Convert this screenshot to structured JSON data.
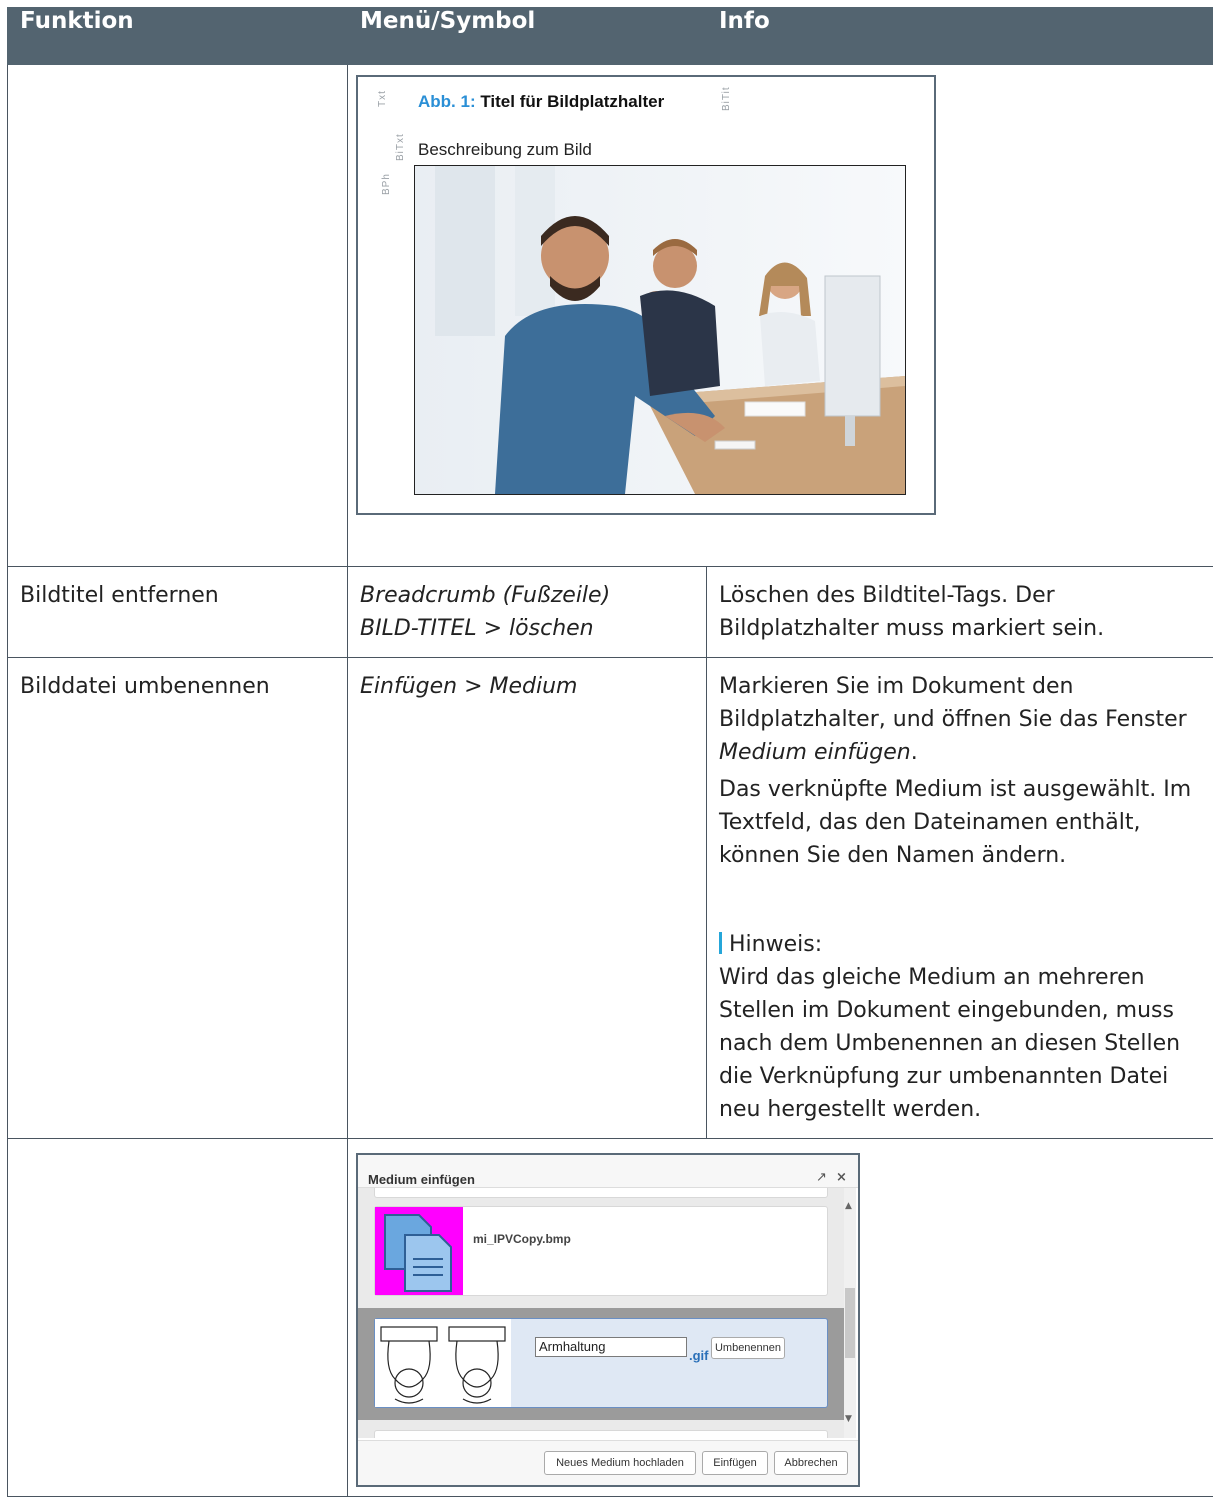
{
  "table": {
    "headers": [
      "Funktion",
      "Menü/Symbol",
      "Info"
    ]
  },
  "figure_placeholder": {
    "side_tags": [
      "Txt",
      "BiTxt",
      "BPh"
    ],
    "title_tag": "BiTit",
    "caption_number": "Abb. 1:",
    "caption_title": "Titel für Bildplatzhalter",
    "description": "Beschreibung zum Bild",
    "photo_icon": "office-photo-icon"
  },
  "rows": [
    {
      "funktion": "Bildtitel entfernen",
      "menu_lines": [
        "Breadcrumb (Fußzeile)",
        "BILD-TITEL > löschen"
      ],
      "info": "Löschen des Bildtitel-Tags. Der Bildplatzhalter muss markiert sein."
    },
    {
      "funktion": "Bilddatei umbenennen",
      "menu": "Einfügen > Medium",
      "info_p1_a": "Markieren Sie im Dokument den Bildplatzhalter, und öffnen Sie das Fenster ",
      "info_p1_b": "Medium einfügen",
      "info_p1_c": ".",
      "info_p2": "Das verknüpfte Medium ist ausgewählt. Im Textfeld, das den Dateinamen enthält, können Sie den Namen ändern.",
      "note_label": "Hinweis:",
      "note_text": "Wird das gleiche Medium an mehreren Stellen im Dokument eingebunden, muss nach dem Umbenennen an diesen Stellen die Verknüpfung zur umbenannten Datei neu hergestellt werden."
    }
  ],
  "dialog": {
    "title": "Medium einfügen",
    "expand_icon": "↗",
    "close_icon": "×",
    "items": [
      {
        "file_name": "mi_IPVCopy.bmp",
        "icon": "copy-document-icon"
      },
      {
        "rename_value": "Armhaltung",
        "extension": ".gif",
        "rename_button": "Umbenennen",
        "icon": "keyboard-posture-icon"
      }
    ],
    "buttons": [
      "Neues Medium hochladen",
      "Einfügen",
      "Abbrechen"
    ]
  },
  "colors": {
    "header_bg": "#536470",
    "accent_blue": "#25a6d9",
    "magenta": "#ff00ff"
  }
}
